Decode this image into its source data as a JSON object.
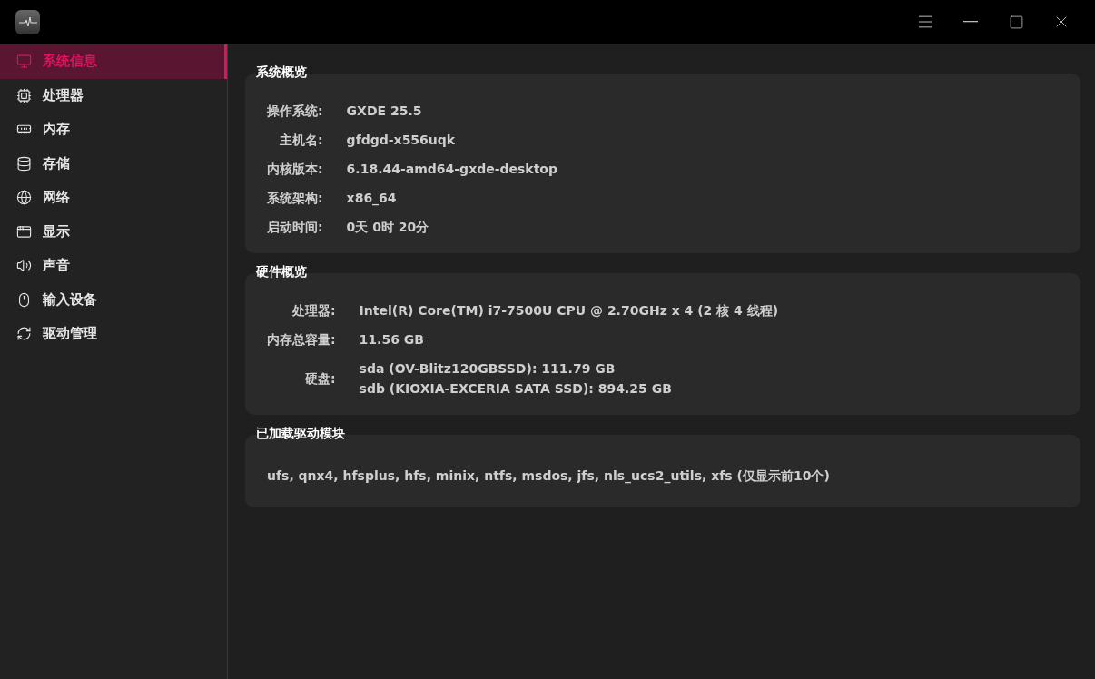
{
  "sidebar": {
    "items": [
      {
        "kind": "system",
        "label": "系统信息",
        "selected": true
      },
      {
        "kind": "cpu",
        "label": "处理器",
        "selected": false
      },
      {
        "kind": "memory",
        "label": "内存",
        "selected": false
      },
      {
        "kind": "storage",
        "label": "存储",
        "selected": false
      },
      {
        "kind": "network",
        "label": "网络",
        "selected": false
      },
      {
        "kind": "display",
        "label": "显示",
        "selected": false
      },
      {
        "kind": "sound",
        "label": "声音",
        "selected": false
      },
      {
        "kind": "input",
        "label": "输入设备",
        "selected": false
      },
      {
        "kind": "driver",
        "label": "驱动管理",
        "selected": false
      }
    ]
  },
  "sections": [
    {
      "title": "系统概览",
      "rows": [
        {
          "label": "操作系统:",
          "values": [
            "GXDE 25.5"
          ]
        },
        {
          "label": "主机名:",
          "values": [
            "gfdgd-x556uqk"
          ]
        },
        {
          "label": "内核版本:",
          "values": [
            "6.18.44-amd64-gxde-desktop"
          ]
        },
        {
          "label": "系统架构:",
          "values": [
            "x86_64"
          ]
        },
        {
          "label": "启动时间:",
          "values": [
            "0天 0时 20分"
          ]
        }
      ]
    },
    {
      "title": "硬件概览",
      "rows": [
        {
          "label": "处理器:",
          "values": [
            "Intel(R) Core(TM) i7-7500U CPU @ 2.70GHz x 4 (2 核 4 线程)"
          ]
        },
        {
          "label": "内存总容量:",
          "values": [
            "11.56 GB"
          ]
        },
        {
          "label": "硬盘:",
          "values": [
            "sda (OV-Blitz120GBSSD): 111.79 GB",
            "sdb (KIOXIA-EXCERIA SATA SSD): 894.25 GB"
          ]
        }
      ]
    },
    {
      "title": "已加载驱动模块",
      "text": "ufs, qnx4, hfsplus, hfs, minix, ntfs, msdos, jfs, nls_ucs2_utils, xfs (仅显示前10个)"
    }
  ]
}
